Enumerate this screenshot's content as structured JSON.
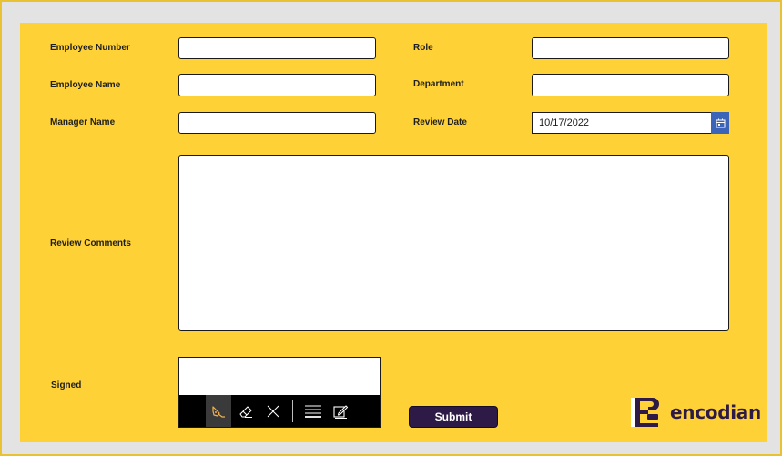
{
  "form": {
    "labels": {
      "employee_number": "Employee Number",
      "employee_name": "Employee Name",
      "manager_name": "Manager Name",
      "role": "Role",
      "department": "Department",
      "review_date": "Review Date",
      "review_comments": "Review Comments",
      "signed": "Signed"
    },
    "values": {
      "employee_number": "",
      "employee_name": "",
      "manager_name": "",
      "role": "",
      "department": "",
      "review_date": "10/17/2022",
      "review_comments": ""
    },
    "submit_label": "Submit"
  },
  "signature_toolbar": {
    "tools": [
      "pen-icon",
      "eraser-icon",
      "clear-icon",
      "line-weight-icon",
      "edit-icon"
    ],
    "active_tool": "pen-icon"
  },
  "brand": {
    "name": "encodian",
    "logo_icon": "encodian-logo-icon",
    "color": "#2e1a47"
  },
  "colors": {
    "panel_background": "#fed137",
    "date_button": "#3b63b8",
    "submit_button": "#2e1a47"
  }
}
